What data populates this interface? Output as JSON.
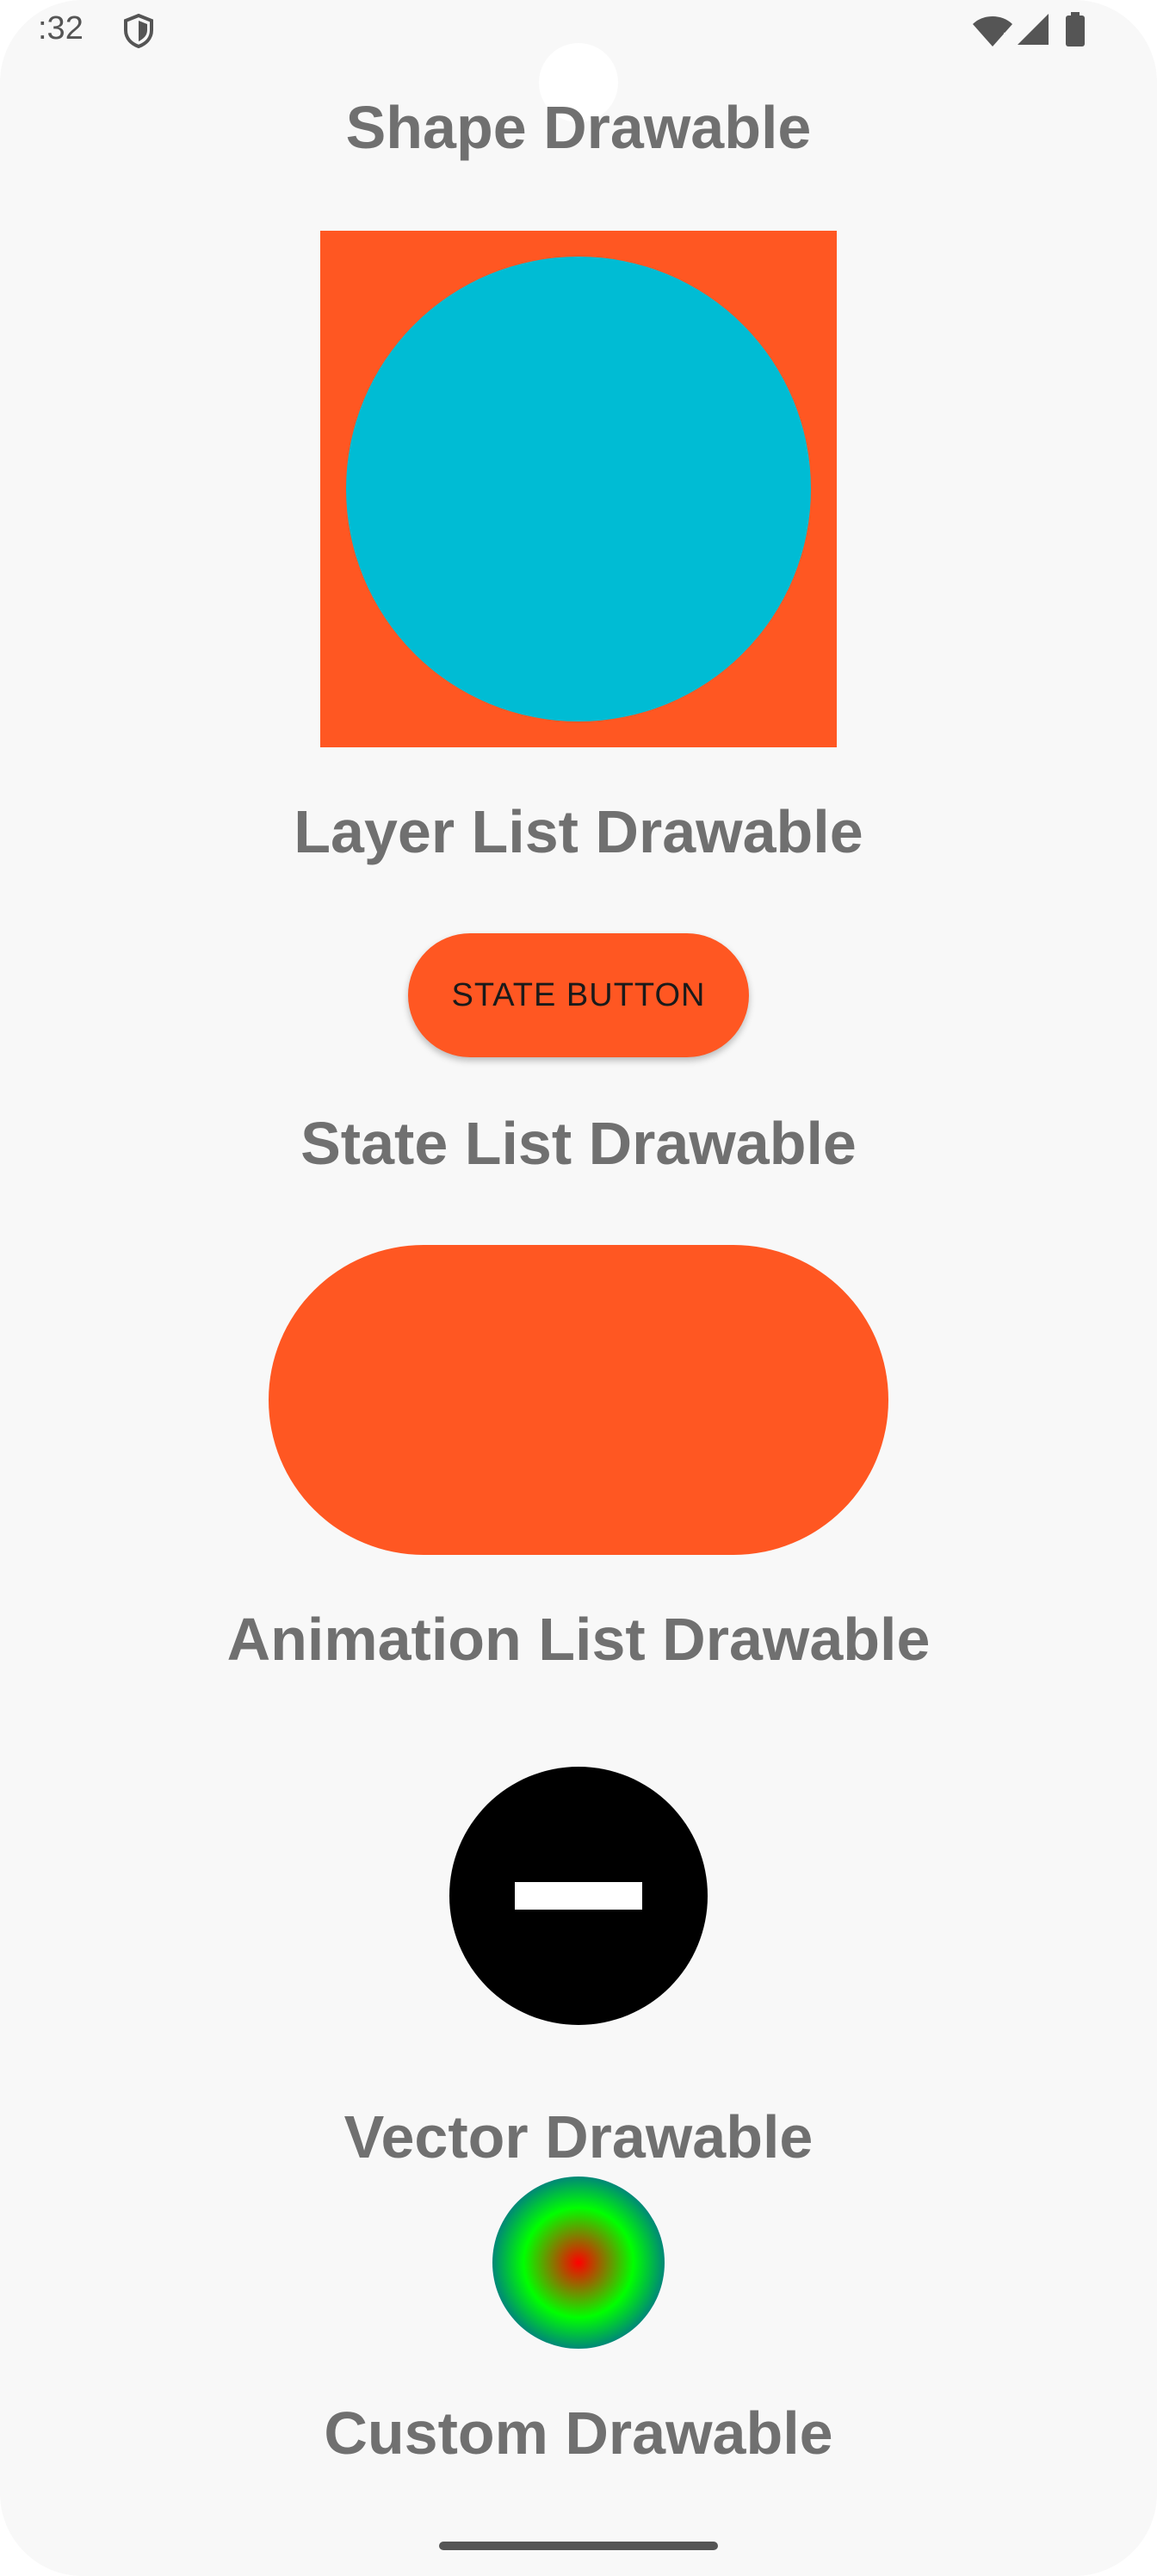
{
  "status_bar": {
    "time": ":32",
    "icons": [
      "shield-icon",
      "wifi-icon",
      "signal-icon",
      "battery-icon"
    ]
  },
  "sections": {
    "shape": {
      "title": "Shape Drawable"
    },
    "layer_list": {
      "title": "Layer List Drawable"
    },
    "state_list": {
      "title": "State List Drawable",
      "button_label": "STATE BUTTON"
    },
    "animation_list": {
      "title": "Animation List Drawable"
    },
    "vector": {
      "title": "Vector Drawable"
    },
    "custom": {
      "title": "Custom Drawable"
    }
  },
  "colors": {
    "accent_orange": "#ff5722",
    "cyan": "#00bcd4",
    "title_gray": "#707070",
    "black": "#000000",
    "white": "#ffffff",
    "gradient_center": "#ff0000",
    "gradient_mid": "#00ff00",
    "gradient_edge": "#0000ff"
  }
}
